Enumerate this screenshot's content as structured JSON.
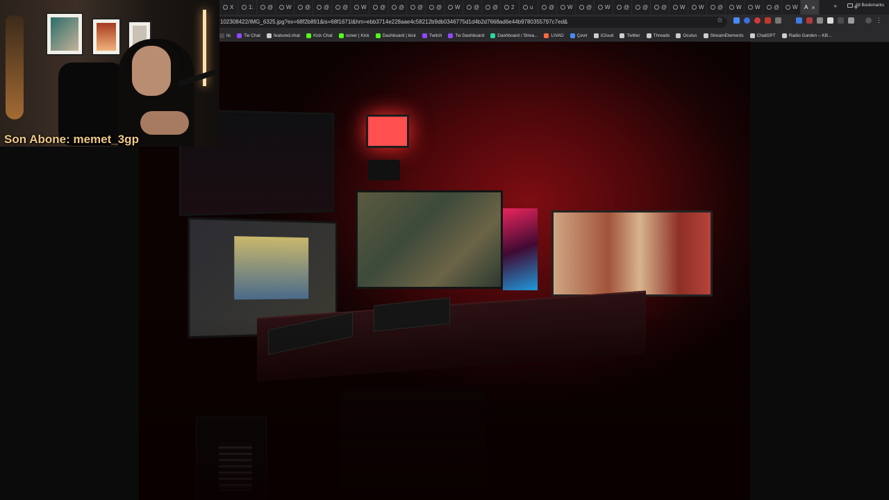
{
  "browser": {
    "tabs": [
      {
        "label": "X"
      },
      {
        "label": "1:"
      },
      {
        "label": "@"
      },
      {
        "label": "W"
      },
      {
        "label": "@"
      },
      {
        "label": "@"
      },
      {
        "label": "@"
      },
      {
        "label": "W"
      },
      {
        "label": "@"
      },
      {
        "label": "@"
      },
      {
        "label": "@"
      },
      {
        "label": "@"
      },
      {
        "label": "W"
      },
      {
        "label": "@"
      },
      {
        "label": "@"
      },
      {
        "label": "2"
      },
      {
        "label": "u"
      },
      {
        "label": "@"
      },
      {
        "label": "W"
      },
      {
        "label": "@"
      },
      {
        "label": "W"
      },
      {
        "label": "@"
      },
      {
        "label": "@"
      },
      {
        "label": "@"
      },
      {
        "label": "W"
      },
      {
        "label": "W"
      },
      {
        "label": "@"
      },
      {
        "label": "W"
      },
      {
        "label": "W"
      },
      {
        "label": "@"
      },
      {
        "label": "W"
      }
    ],
    "active_tab_label": "A",
    "active_tab_close": "×",
    "new_tab": "+",
    "url": "102308422/IMG_6325.jpg?ex=68f2b891&is=68f1671l&hm=ebb3714e228aae4c58212b9db0346775d1d4b2d7668ad6e44b9780355797c7ed&",
    "star": "☆",
    "bookmarks": [
      {
        "label": "ils",
        "color": "#4a4a4e"
      },
      {
        "label": "Tw Chat",
        "color": "#9146ff"
      },
      {
        "label": "featured.chat",
        "color": "#cccccc"
      },
      {
        "label": "Kick Chat",
        "color": "#53fc18"
      },
      {
        "label": "soner | Kick",
        "color": "#53fc18"
      },
      {
        "label": "Dashboard | kick",
        "color": "#53fc18"
      },
      {
        "label": "Twitch",
        "color": "#9146ff"
      },
      {
        "label": "Tw Dashboard",
        "color": "#9146ff"
      },
      {
        "label": "Dashboard / Strea...",
        "color": "#2bd4a0"
      },
      {
        "label": "LIVAD",
        "color": "#ff6a3d"
      },
      {
        "label": "Çevir",
        "color": "#4a8af4"
      },
      {
        "label": "iCloud",
        "color": "#cccccc"
      },
      {
        "label": "Twitter",
        "color": "#cccccc"
      },
      {
        "label": "Threads",
        "color": "#cccccc"
      },
      {
        "label": "Oculus",
        "color": "#cccccc"
      },
      {
        "label": "StreamElements",
        "color": "#cccccc"
      },
      {
        "label": "ChatGPT",
        "color": "#cccccc"
      },
      {
        "label": "Radio Garden – KB...",
        "color": "#cccccc"
      }
    ],
    "bookmarks_more": "»",
    "all_bookmarks": "All Bookmarks"
  },
  "overlay": {
    "subscriber_text": "Son Abone: memet_3gp"
  },
  "colors": {
    "accent_red": "#7d0d12",
    "subscriber_text": "#f0c888"
  }
}
